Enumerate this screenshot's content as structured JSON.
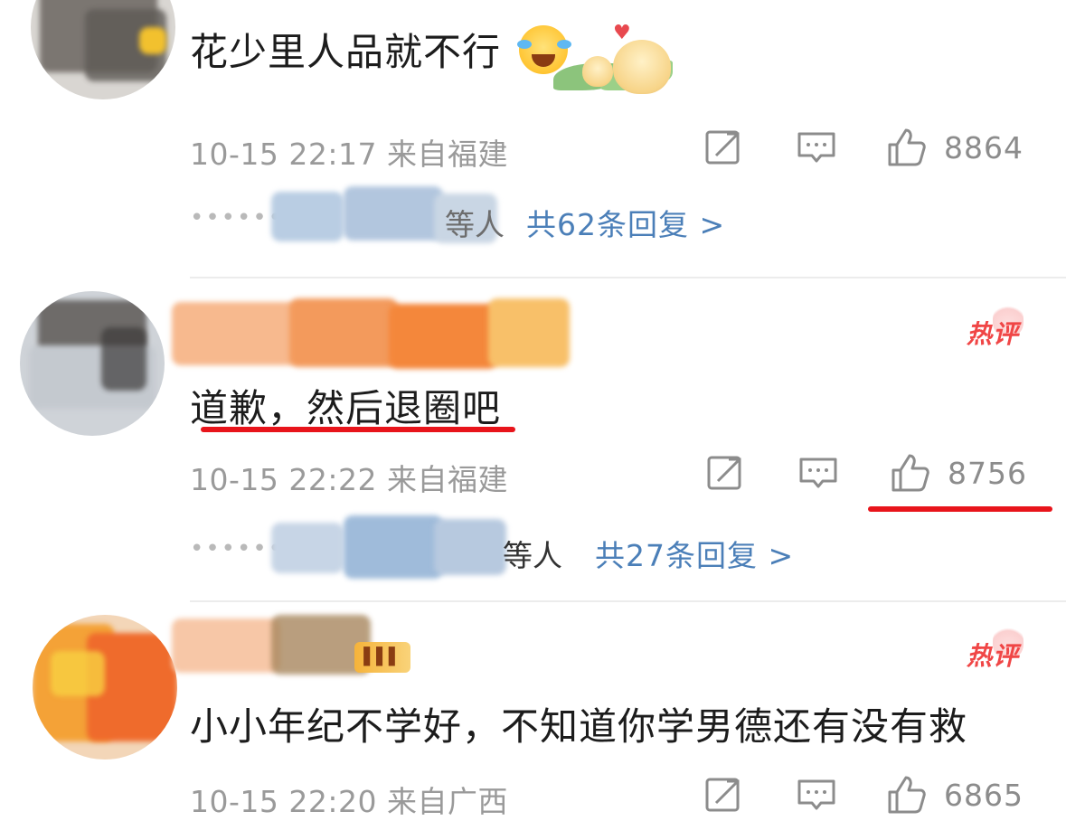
{
  "comments": [
    {
      "content": "花少里人品就不行",
      "meta": "10-15 22:17  来自福建",
      "likes": "8864",
      "replies": {
        "names_suffix": "等人",
        "link": "共62条回复 >"
      },
      "icons": [
        "share-icon",
        "comment-icon",
        "thumbs-up-icon"
      ]
    },
    {
      "hot_label": "热评",
      "content": "道歉，然后退圈吧",
      "meta": "10-15 22:22  来自福建",
      "likes": "8756",
      "replies": {
        "names_suffix": "等人",
        "link": "共27条回复 >"
      },
      "icons": [
        "share-icon",
        "comment-icon",
        "thumbs-up-icon"
      ]
    },
    {
      "hot_label": "热评",
      "content": "小小年纪不学好，不知道你学男德还有没有救",
      "meta": "10-15 22:20  来自广西",
      "likes": "6865",
      "icons": [
        "share-icon",
        "comment-icon",
        "thumbs-up-icon"
      ]
    }
  ],
  "colors": {
    "link": "#4b7fb8",
    "hot": "#f04646",
    "annotation_underline": "#e8141b",
    "meta": "#9a9a9a"
  }
}
